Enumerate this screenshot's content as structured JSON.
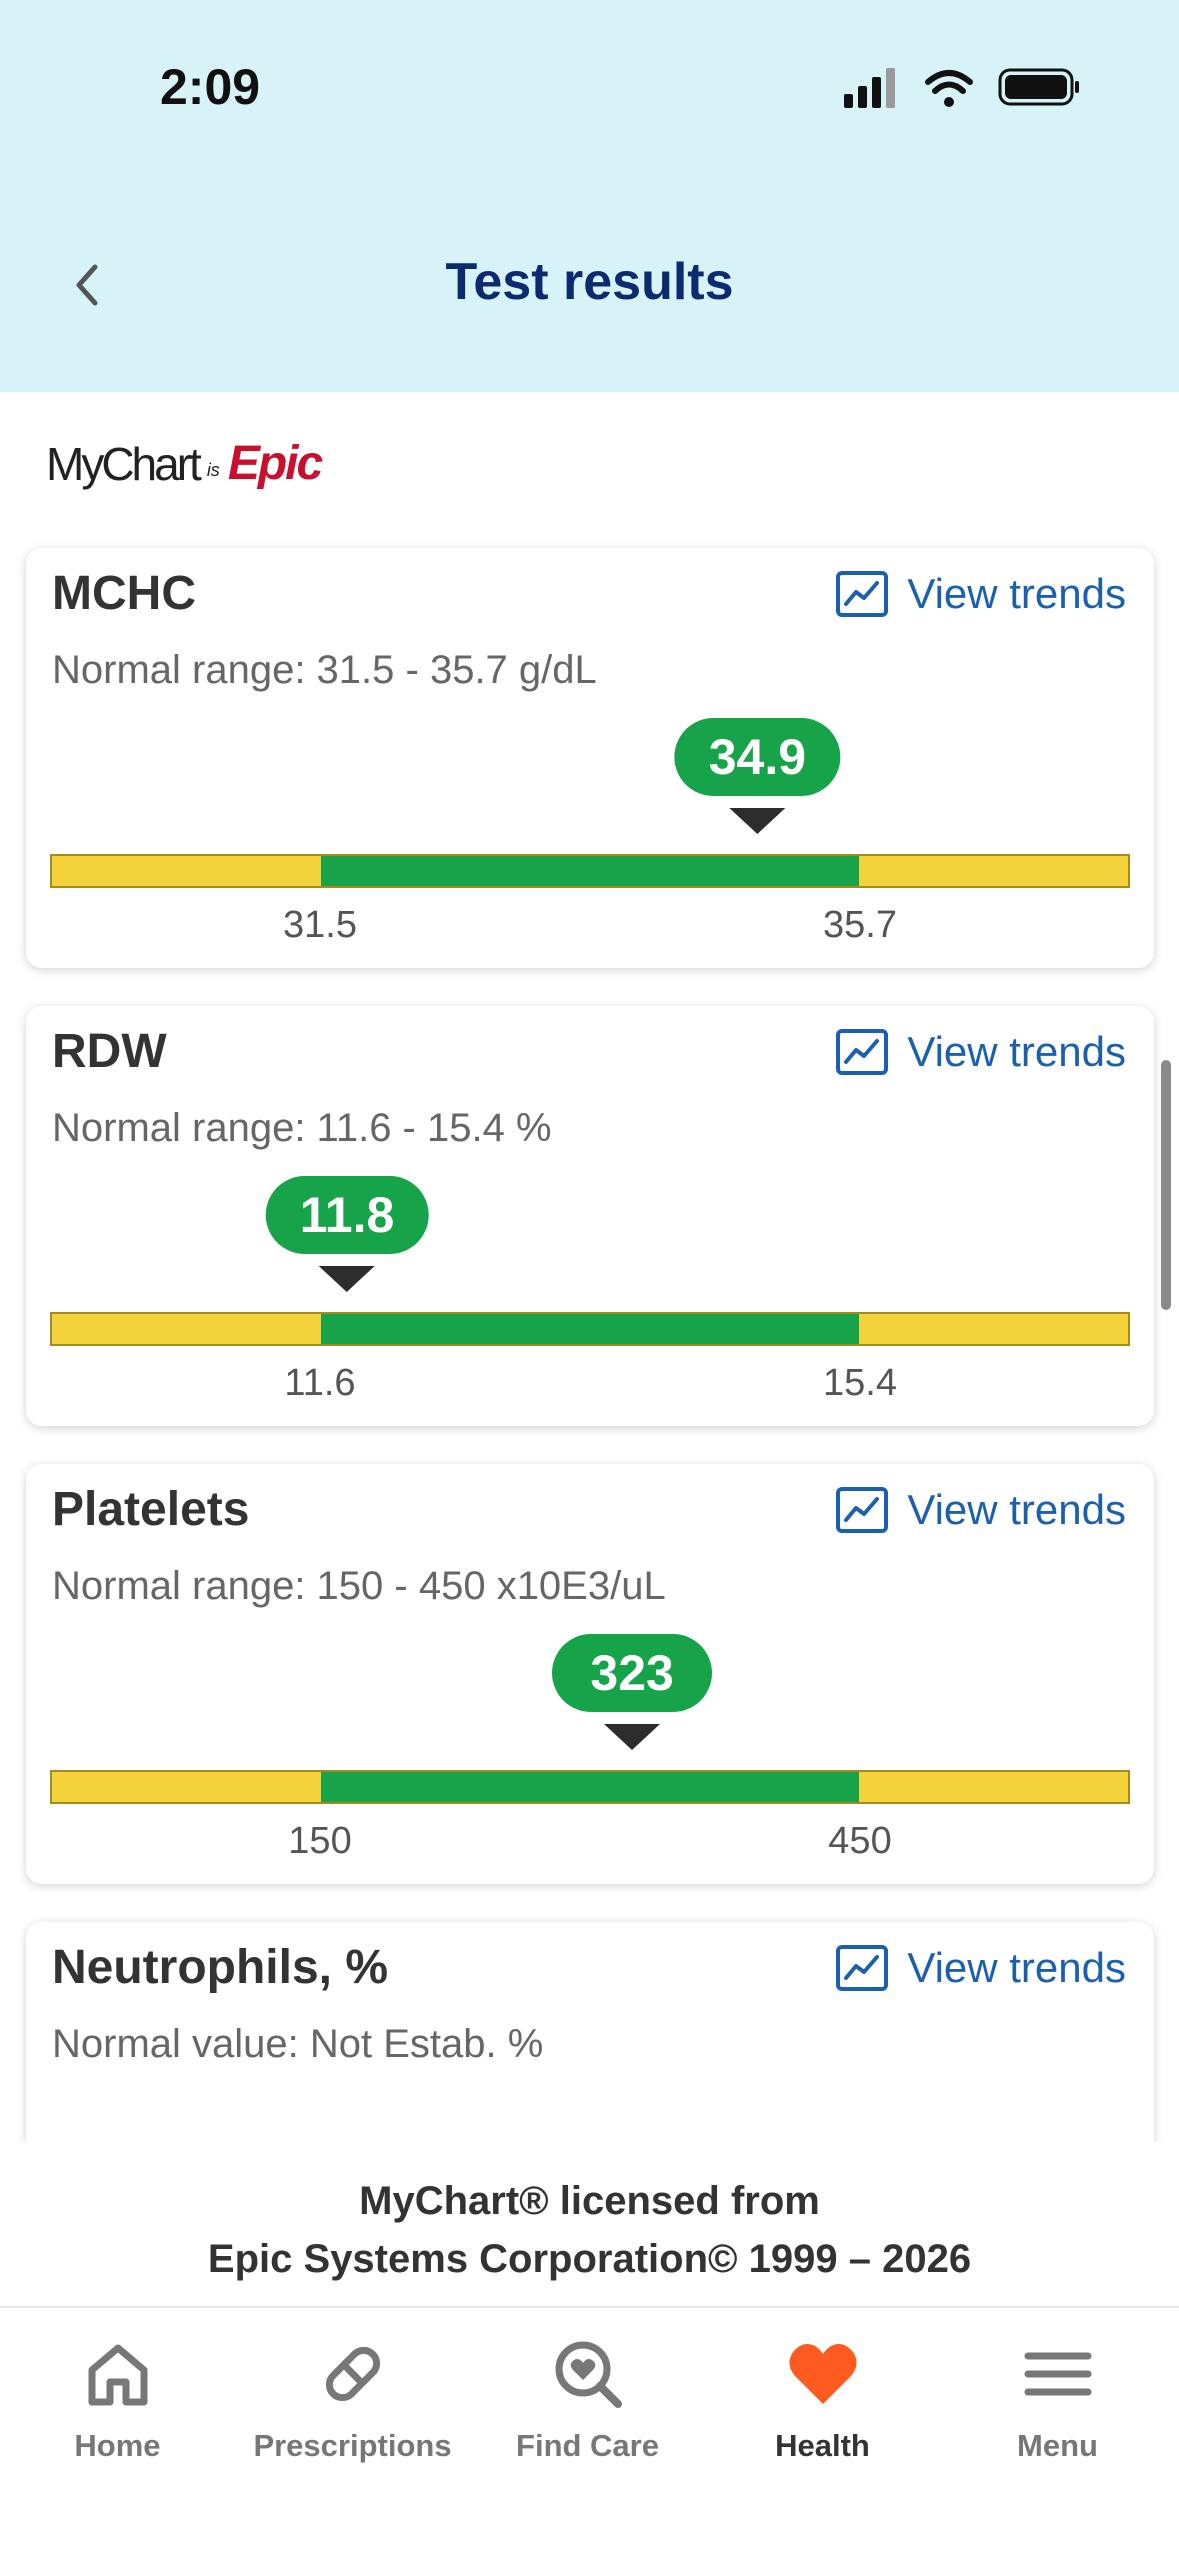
{
  "status": {
    "time": "2:09"
  },
  "header": {
    "title": "Test results"
  },
  "logo": {
    "mychart": "MyChart",
    "is": "is",
    "epic": "Epic"
  },
  "results": [
    {
      "name": "MCHC",
      "range_text": "Normal range: 31.5 - 35.7 g/dL",
      "value": "34.9",
      "low": "31.5",
      "high": "35.7",
      "position_fraction": 0.655
    },
    {
      "name": "RDW",
      "range_text": "Normal range: 11.6 - 15.4 %",
      "value": "11.8",
      "low": "11.6",
      "high": "15.4",
      "position_fraction": 0.275
    },
    {
      "name": "Platelets",
      "range_text": "Normal range: 150 - 450 x10E3/uL",
      "value": "323",
      "low": "150",
      "high": "450",
      "position_fraction": 0.539
    },
    {
      "name": "Neutrophils, %",
      "range_text": "Normal value: Not Estab. %"
    }
  ],
  "trends_label": "View trends",
  "license": {
    "line1": "MyChart® licensed from",
    "line2": "Epic Systems Corporation© 1999 – 2026"
  },
  "nav": {
    "items": [
      {
        "label": "Home",
        "icon": "home-icon"
      },
      {
        "label": "Prescriptions",
        "icon": "pill-icon"
      },
      {
        "label": "Find Care",
        "icon": "search-heart-icon"
      },
      {
        "label": "Health",
        "icon": "heart-icon"
      },
      {
        "label": "Menu",
        "icon": "menu-icon"
      }
    ],
    "active": "Health"
  },
  "colors": {
    "header_bg": "#d7f3f8",
    "title": "#0b2a6f",
    "normal": "#16a34a",
    "out_of_range": "#f4d23b",
    "link": "#1b5fb0",
    "active_nav": "#ff5a1f"
  }
}
